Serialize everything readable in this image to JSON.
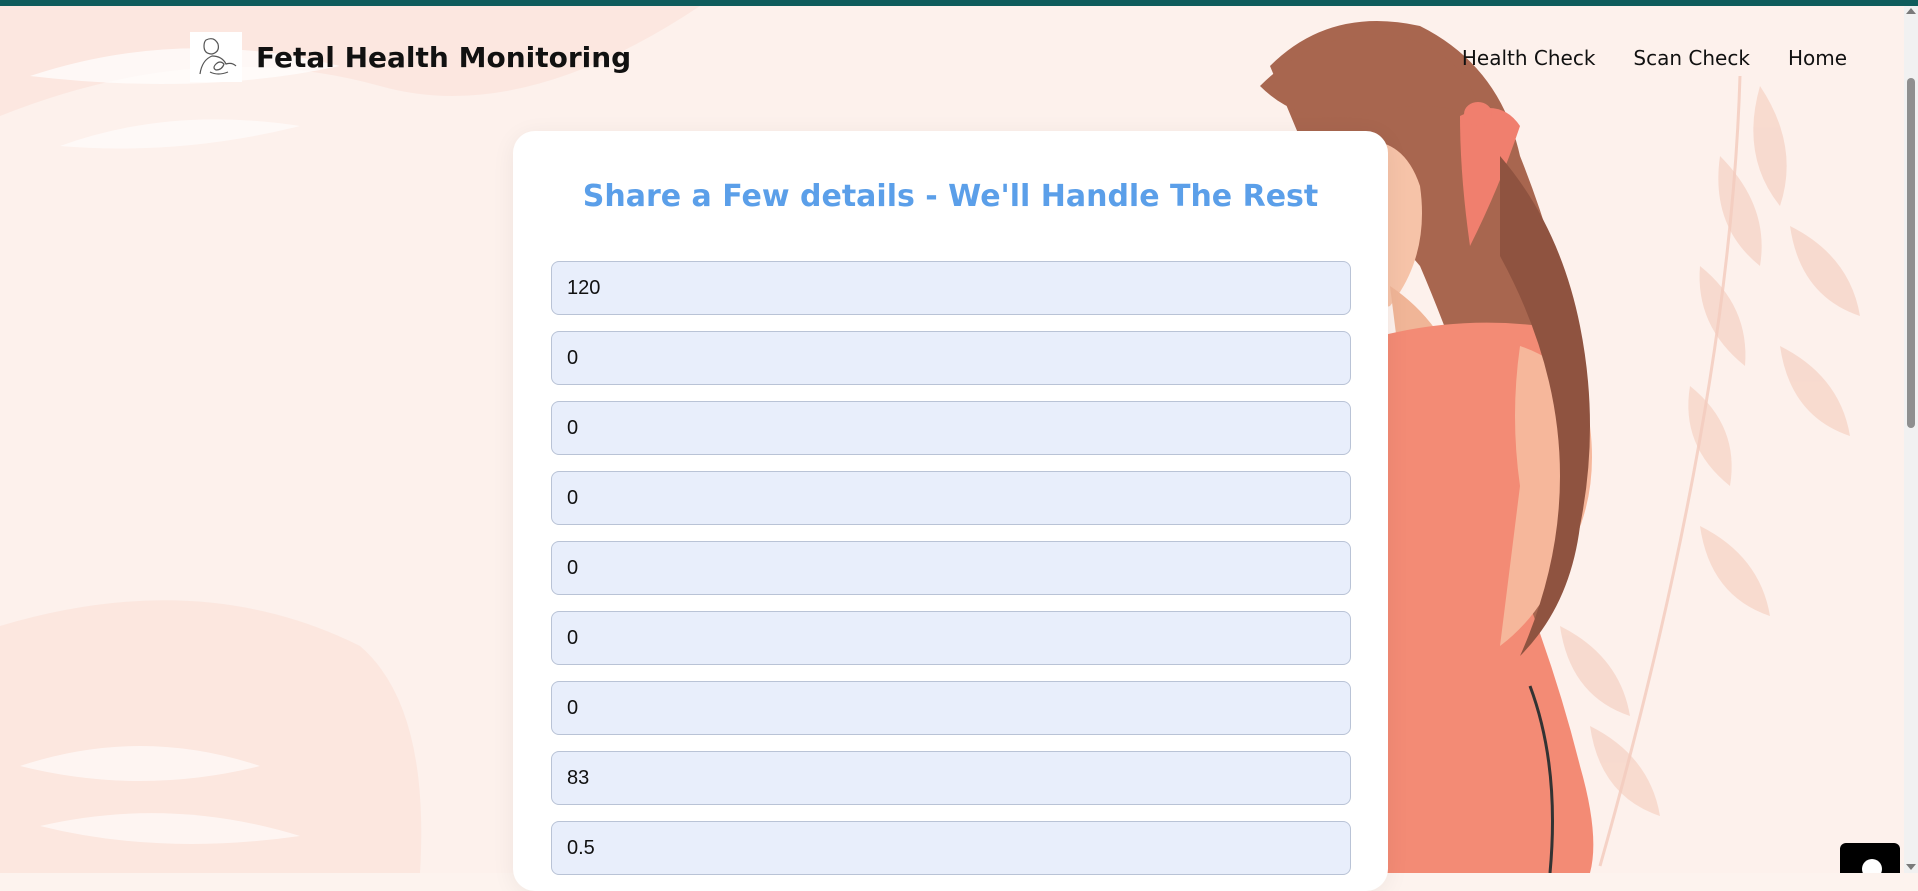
{
  "header": {
    "title": "Fetal Health Monitoring",
    "logo_icon": "mother-baby-icon"
  },
  "nav": {
    "items": [
      "Health Check",
      "Scan Check",
      "Home"
    ]
  },
  "form": {
    "title": "Share a Few details - We'll Handle The Rest",
    "fields": [
      "120",
      "0",
      "0",
      "0",
      "0",
      "0",
      "0",
      "83",
      "0.5"
    ]
  },
  "colors": {
    "topbar": "#0f5c5c",
    "title_blue": "#5b9fe9",
    "field_bg": "#e8eefb",
    "dress": "#f38b75",
    "hair": "#a8664f"
  }
}
